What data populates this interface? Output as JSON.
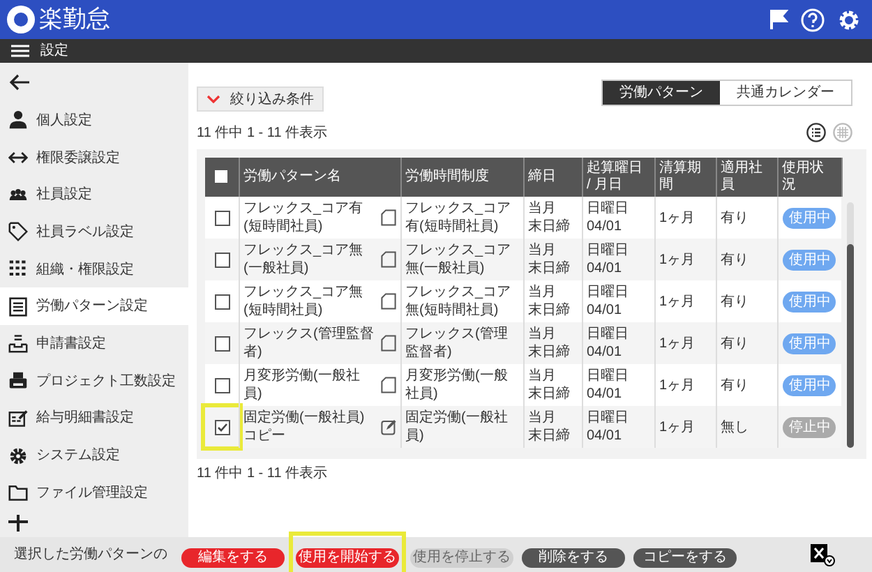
{
  "app": {
    "title": "楽勤怠"
  },
  "nav": {
    "title": "設定"
  },
  "sidebar": {
    "items": [
      {
        "label": "個人設定",
        "selected": false
      },
      {
        "label": "権限委譲設定",
        "selected": false
      },
      {
        "label": "社員設定",
        "selected": false
      },
      {
        "label": "社員ラベル設定",
        "selected": false
      },
      {
        "label": "組織・権限設定",
        "selected": false
      },
      {
        "label": "労働パターン設定",
        "selected": true
      },
      {
        "label": "申請書設定",
        "selected": false
      },
      {
        "label": "プロジェクト工数設定",
        "selected": false
      },
      {
        "label": "給与明細書設定",
        "selected": false
      },
      {
        "label": "システム設定",
        "selected": false
      },
      {
        "label": "ファイル管理設定",
        "selected": false
      }
    ]
  },
  "filter": {
    "label": "絞り込み条件"
  },
  "view_tabs": [
    {
      "label": "労働パターン",
      "selected": true
    },
    {
      "label": "共通カレンダー",
      "selected": false
    }
  ],
  "count_top": "11 件中 1 - 11 件表示",
  "count_bottom": "11 件中 1 - 11 件表示",
  "table": {
    "all_checked": false,
    "columns": [
      "労働パターン名",
      "労働時間制度",
      "締日",
      "起算曜日 / 月日",
      "清算期間",
      "適用社員",
      "使用状況"
    ],
    "rows": [
      {
        "checked": false,
        "highlighted": false,
        "name": "フレックス_コア有(短時間社員)",
        "editable": false,
        "system": "フレックス_コア有(短時間社員)",
        "closing": [
          "当月",
          "末日締"
        ],
        "start": [
          "日曜日",
          "04/01"
        ],
        "period": "1ヶ月",
        "applied": "有り",
        "status": "使用中",
        "active": true
      },
      {
        "checked": false,
        "highlighted": false,
        "name": "フレックス_コア無(一般社員)",
        "editable": false,
        "system": "フレックス_コア無(一般社員)",
        "closing": [
          "当月",
          "末日締"
        ],
        "start": [
          "日曜日",
          "04/01"
        ],
        "period": "1ヶ月",
        "applied": "有り",
        "status": "使用中",
        "active": true
      },
      {
        "checked": false,
        "highlighted": false,
        "name": "フレックス_コア無(短時間社員)",
        "editable": false,
        "system": "フレックス_コア無(短時間社員)",
        "closing": [
          "当月",
          "末日締"
        ],
        "start": [
          "日曜日",
          "04/01"
        ],
        "period": "1ヶ月",
        "applied": "有り",
        "status": "使用中",
        "active": true
      },
      {
        "checked": false,
        "highlighted": false,
        "name": "フレックス(管理監督者)",
        "editable": false,
        "system": "フレックス(管理監督者)",
        "closing": [
          "当月",
          "末日締"
        ],
        "start": [
          "日曜日",
          "04/01"
        ],
        "period": "1ヶ月",
        "applied": "有り",
        "status": "使用中",
        "active": true
      },
      {
        "checked": false,
        "highlighted": false,
        "name": "月変形労働(一般社員)",
        "editable": false,
        "system": "月変形労働(一般社員)",
        "closing": [
          "当月",
          "末日締"
        ],
        "start": [
          "日曜日",
          "04/01"
        ],
        "period": "1ヶ月",
        "applied": "有り",
        "status": "使用中",
        "active": true
      },
      {
        "checked": true,
        "highlighted": true,
        "name": "固定労働(一般社員) コピー",
        "editable": true,
        "system": "固定労働(一般社員)",
        "closing": [
          "当月",
          "末日締"
        ],
        "start": [
          "日曜日",
          "04/01"
        ],
        "period": "1ヶ月",
        "applied": "無し",
        "status": "停止中",
        "active": false
      }
    ]
  },
  "footer": {
    "label": "選択した労働パターンの",
    "buttons": [
      {
        "label": "編集をする",
        "kind": "primary",
        "highlighted": false
      },
      {
        "label": "使用を開始する",
        "kind": "primary",
        "highlighted": true
      },
      {
        "label": "使用を停止する",
        "kind": "disabled",
        "highlighted": false
      },
      {
        "label": "削除をする",
        "kind": "dark",
        "highlighted": false
      },
      {
        "label": "コピーをする",
        "kind": "dark",
        "highlighted": false
      }
    ]
  }
}
